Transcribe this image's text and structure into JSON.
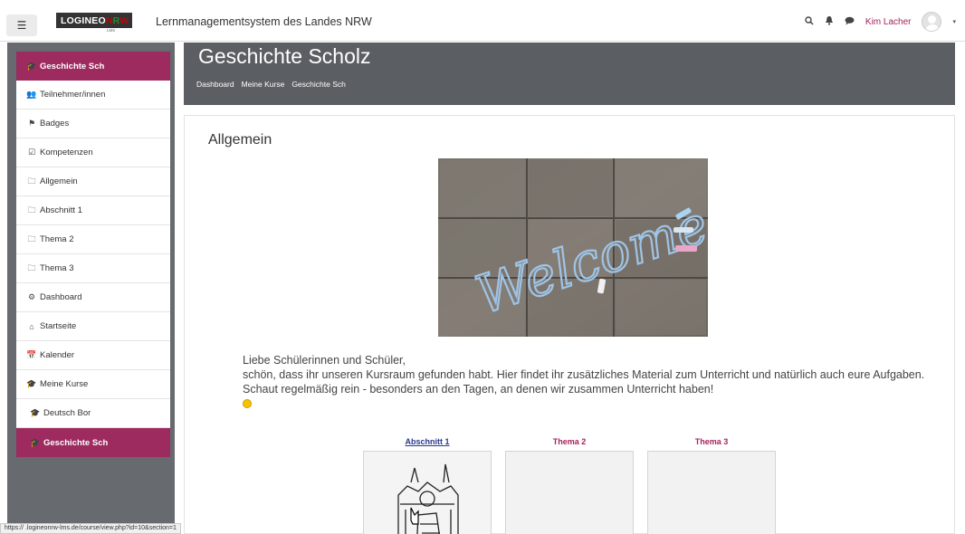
{
  "navbar": {
    "menu_icon": "hamburger-icon",
    "logo_left": "LOGINEO",
    "logo_n": "N",
    "logo_r": "R",
    "logo_w": "W",
    "logo_sub": "LMS",
    "site_title": "Lernmanagementsystem des Landes NRW",
    "search_icon": "search-icon",
    "bell_icon": "bell-icon",
    "message_icon": "chat-icon",
    "user_name": "Kim Lacher",
    "caret": "▾"
  },
  "sidebar": {
    "course_items": [
      {
        "label": "Geschichte Sch",
        "icon": "graduation-cap-icon"
      },
      {
        "label": "Teilnehmer/innen",
        "icon": "users-icon"
      },
      {
        "label": "Badges",
        "icon": "shield-icon"
      },
      {
        "label": "Kompetenzen",
        "icon": "checkbox-icon"
      },
      {
        "label": "Allgemein",
        "icon": "folder-icon"
      },
      {
        "label": "Abschnitt 1",
        "icon": "folder-icon"
      },
      {
        "label": "Thema 2",
        "icon": "folder-icon"
      },
      {
        "label": "Thema 3",
        "icon": "folder-icon"
      }
    ],
    "site_items": [
      {
        "label": "Dashboard",
        "icon": "dashboard-icon"
      },
      {
        "label": "Startseite",
        "icon": "home-icon"
      },
      {
        "label": "Kalender",
        "icon": "calendar-icon"
      },
      {
        "label": "Meine Kurse",
        "icon": "graduation-cap-icon"
      },
      {
        "label": "Deutsch Bor",
        "icon": "graduation-cap-icon"
      },
      {
        "label": "Geschichte Sch",
        "icon": "graduation-cap-icon"
      }
    ]
  },
  "header": {
    "title": "Geschichte Scholz",
    "breadcrumb": [
      "Dashboard",
      "Meine Kurse",
      "Geschichte Sch"
    ]
  },
  "main": {
    "section_title": "Allgemein",
    "welcome_word": "Welcome",
    "intro_line1": "Liebe Schülerinnen und Schüler,",
    "intro_line2": "schön, dass ihr unseren Kursraum gefunden habt. Hier findet ihr zusätzliches Material zum Unterricht und natürlich auch eure Aufgaben. Schaut regelmäßig rein - besonders an den Tagen, an denen wir zusammen Unterricht haben!",
    "tiles": [
      {
        "title": "Abschnitt 1"
      },
      {
        "title": "Thema 2"
      },
      {
        "title": "Thema 3"
      }
    ]
  },
  "statusbar": {
    "url": "https://          .logineonrw-lms.de/course/view.php?id=10&section=1"
  },
  "colors": {
    "accent": "#9d2b5f",
    "header_bg": "#5b5e62",
    "sidebar_bg": "#676a6e"
  }
}
